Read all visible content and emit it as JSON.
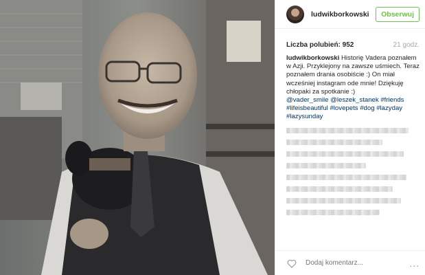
{
  "header": {
    "username": "ludwikborkowski",
    "follow_label": "Obserwuj"
  },
  "meta": {
    "likes": "Liczba polubień: 952",
    "time": "21 godz."
  },
  "caption": {
    "author": "ludwikborkowski",
    "text": "Historię Vadera poznałem w Azji. Przyklejony na zawsze uśmiech. Teraz poznałem drania osobiście :) On miał wcześniej instagram ode mnie! Dziękuję chłopaki za spotkanie :)",
    "tags_line1": "@vader_smile @leszek_stanek #friends",
    "tags_line2": "#lifeisbeautiful #lovepets #dog #lazyday",
    "tags_line3": "#lazysunday"
  },
  "footer": {
    "comment_placeholder": "Dodaj komentarz...",
    "more": "..."
  },
  "icons": {
    "like": "heart-icon",
    "more": "more-options-icon"
  },
  "colors": {
    "follow": "#70c050",
    "hashtag": "#003569",
    "time": "#a5a7aa"
  }
}
